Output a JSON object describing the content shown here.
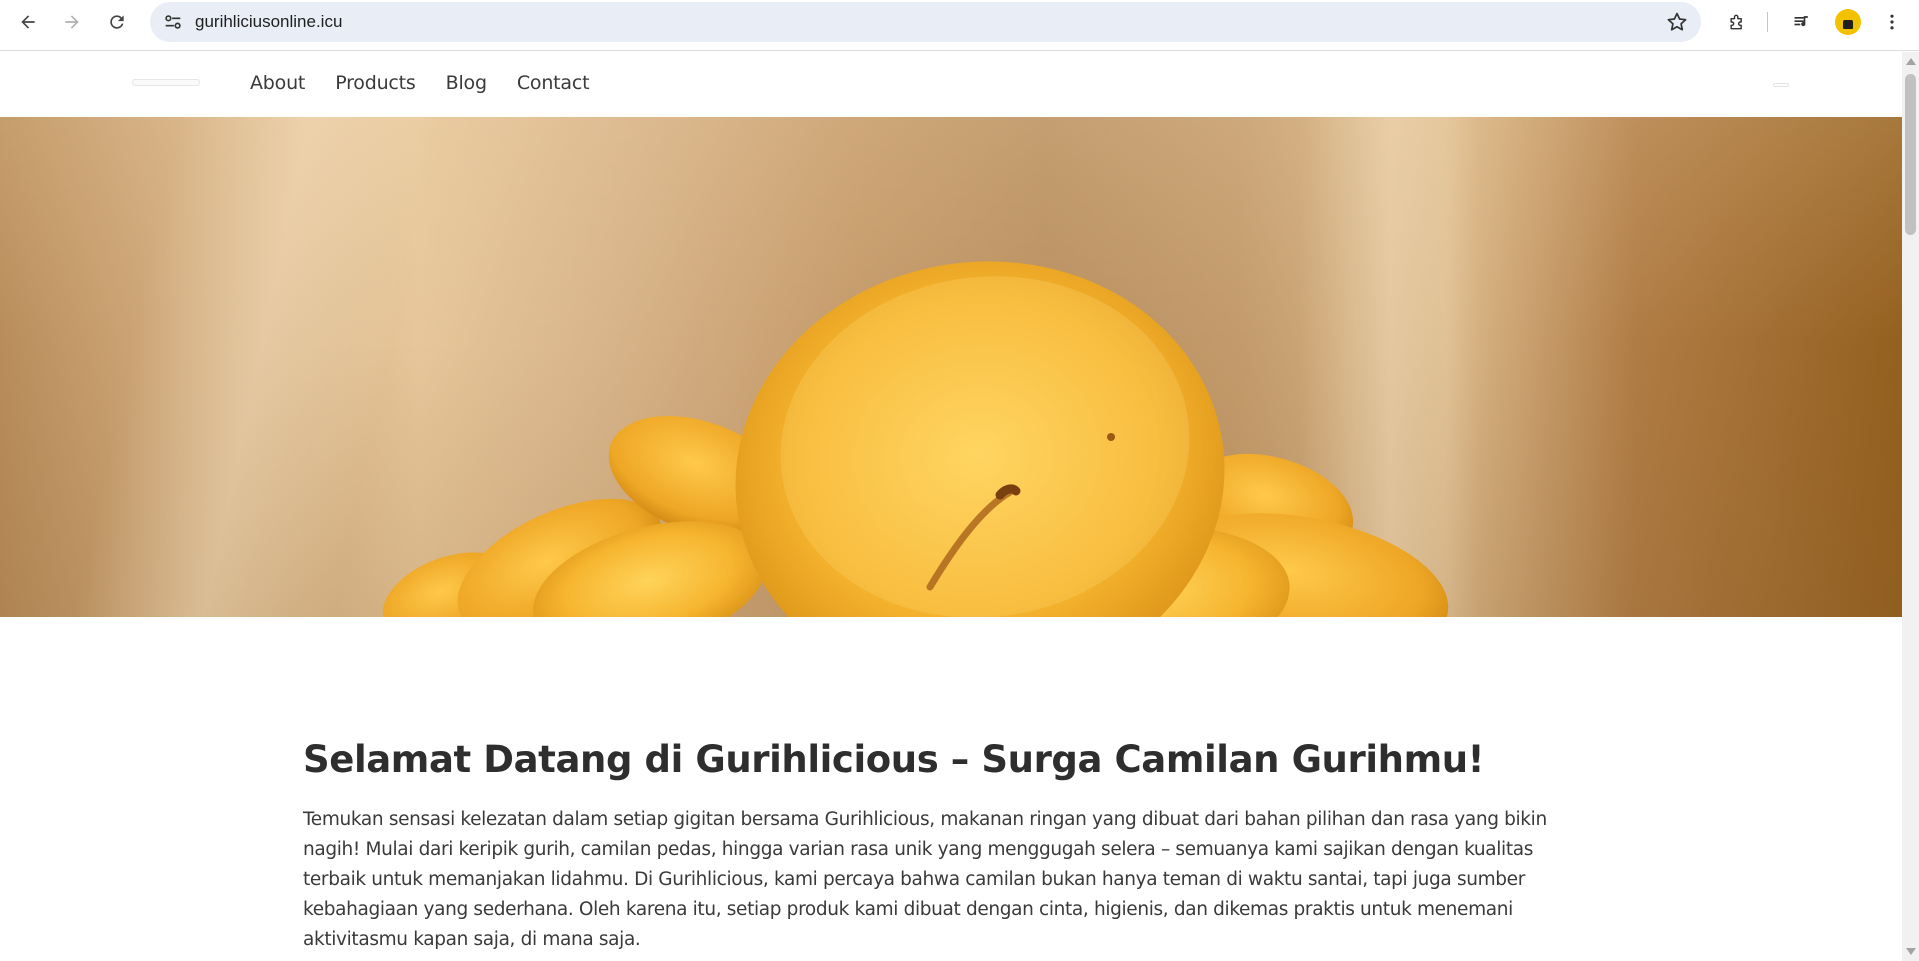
{
  "browser": {
    "url": "gurihliciusonline.icu",
    "icons": [
      "back-arrow-icon",
      "forward-arrow-icon",
      "reload-icon",
      "site-settings-icon",
      "bookmark-star-icon",
      "extensions-icon",
      "media-controls-icon",
      "profile-avatar-icon",
      "more-menu-icon"
    ],
    "accent": "#f2c200"
  },
  "nav": {
    "links": [
      "About",
      "Products",
      "Blog",
      "Contact"
    ]
  },
  "hero": {
    "image": "banana chips close-up",
    "colors": {
      "background": "#c49a6a",
      "chip": "#f3b531"
    }
  },
  "main": {
    "heading": "Selamat Datang di Gurihlicious – Surga Camilan Gurihmu!",
    "paragraph": "Temukan sensasi kelezatan dalam setiap gigitan bersama Gurihlicious, makanan ringan yang dibuat dari bahan pilihan dan rasa yang bikin nagih! Mulai dari keripik gurih, camilan pedas, hingga varian rasa unik yang menggugah selera – semuanya kami sajikan dengan kualitas terbaik untuk memanjakan lidahmu. Di Gurihlicious, kami percaya bahwa camilan bukan hanya teman di waktu santai, tapi juga sumber kebahagiaan yang sederhana. Oleh karena itu, setiap produk kami dibuat dengan cinta, higienis, dan dikemas praktis untuk menemani aktivitasmu kapan saja, di mana saja."
  }
}
